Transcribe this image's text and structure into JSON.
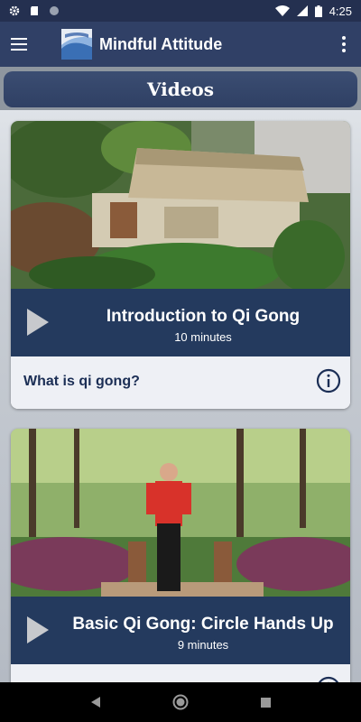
{
  "status_bar": {
    "time": "4:25"
  },
  "app_bar": {
    "title": "Mindful Attitude"
  },
  "section": {
    "title": "Videos"
  },
  "videos": [
    {
      "title": "Introduction to Qi Gong",
      "duration": "10 minutes",
      "description": "What is qi gong?"
    },
    {
      "title": "Basic Qi Gong: Circle Hands Up",
      "duration": "9 minutes",
      "description": ""
    }
  ],
  "colors": {
    "app_bar": "#304066",
    "video_bar": "#243a5e",
    "accent_text": "#1b2e55"
  }
}
